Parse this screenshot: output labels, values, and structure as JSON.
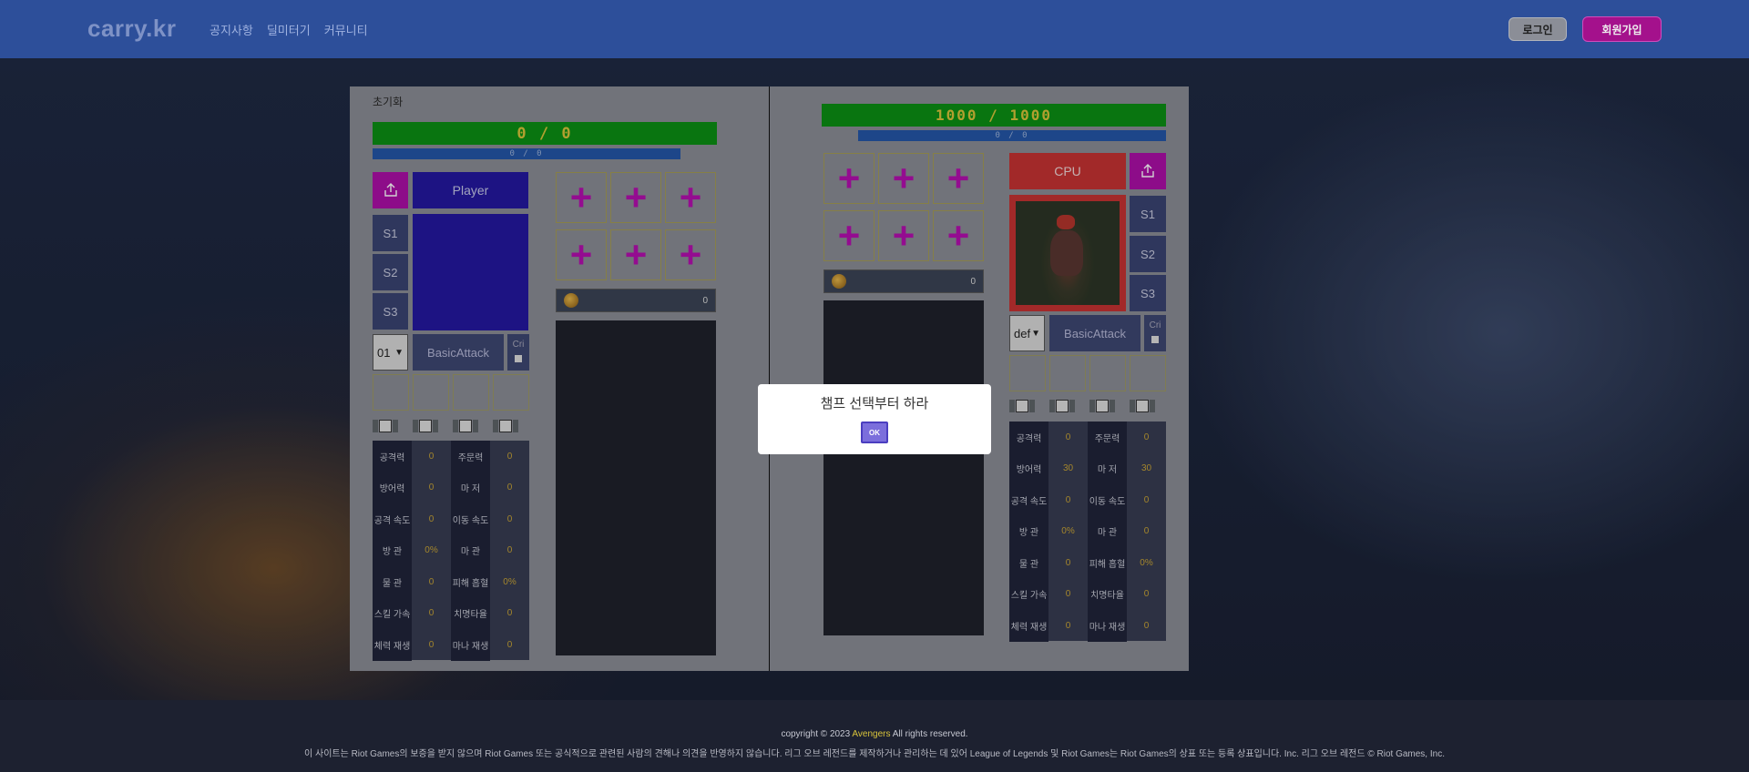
{
  "header": {
    "logo": "carry.kr",
    "nav": [
      "공지사항",
      "딜미터기",
      "커뮤니티"
    ],
    "login": "로그인",
    "signup": "회원가입"
  },
  "left": {
    "reset": "초기화",
    "hp": "0 / 0",
    "mp": "0 / 0",
    "name": "Player",
    "skills": [
      "S1",
      "S2",
      "S3"
    ],
    "level": "01",
    "attack": "BasicAttack",
    "cri": "Cri",
    "gold": "0",
    "stats": [
      [
        "공격력",
        "0",
        "주문력",
        "0"
      ],
      [
        "방어력",
        "0",
        "마 저",
        "0"
      ],
      [
        "공격 속도",
        "0",
        "이동 속도",
        "0"
      ],
      [
        "방 관",
        "0%",
        "마 관",
        "0"
      ],
      [
        "물 관",
        "0",
        "피해 흡혈",
        "0%"
      ],
      [
        "스킬 가속",
        "0",
        "치명타율",
        "0"
      ],
      [
        "체력 재생",
        "0",
        "마나 재생",
        "0"
      ]
    ]
  },
  "right": {
    "hp": "1000 / 1000",
    "mp": "0 / 0",
    "name": "CPU",
    "skills": [
      "S1",
      "S2",
      "S3"
    ],
    "level": "def",
    "attack": "BasicAttack",
    "cri": "Cri",
    "gold": "0",
    "stats": [
      [
        "공격력",
        "0",
        "주문력",
        "0"
      ],
      [
        "방어력",
        "30",
        "마 저",
        "30"
      ],
      [
        "공격 속도",
        "0",
        "이동 속도",
        "0"
      ],
      [
        "방 관",
        "0%",
        "마 관",
        "0"
      ],
      [
        "물 관",
        "0",
        "피해 흡혈",
        "0%"
      ],
      [
        "스킬 가속",
        "0",
        "치명타율",
        "0"
      ],
      [
        "체력 재생",
        "0",
        "마나 재생",
        "0"
      ]
    ]
  },
  "modal": {
    "message": "챔프 선택부터 하라",
    "ok": "OK"
  },
  "footer": {
    "copy_prefix": "copyright © 2023",
    "brand": "Avengers",
    "copy_suffix": "All rights reserved.",
    "legal": "이 사이트는 Riot Games의 보증을 받지 않으며 Riot Games 또는 공식적으로 관련된 사람의 견해나 의견을 반영하지 않습니다. 리그 오브 레전드를 제작하거나 관리하는 데 있어 League of Legends 및 Riot Games는 Riot Games의 상표 또는 등록 상표입니다. Inc. 리그 오브 레전드 © Riot Games, Inc."
  },
  "colors": {
    "header": "#2d4f9a",
    "hp": "#0b8f14",
    "mp": "#2456a8",
    "accent": "#ad0fa8",
    "cpu": "#c63233"
  }
}
